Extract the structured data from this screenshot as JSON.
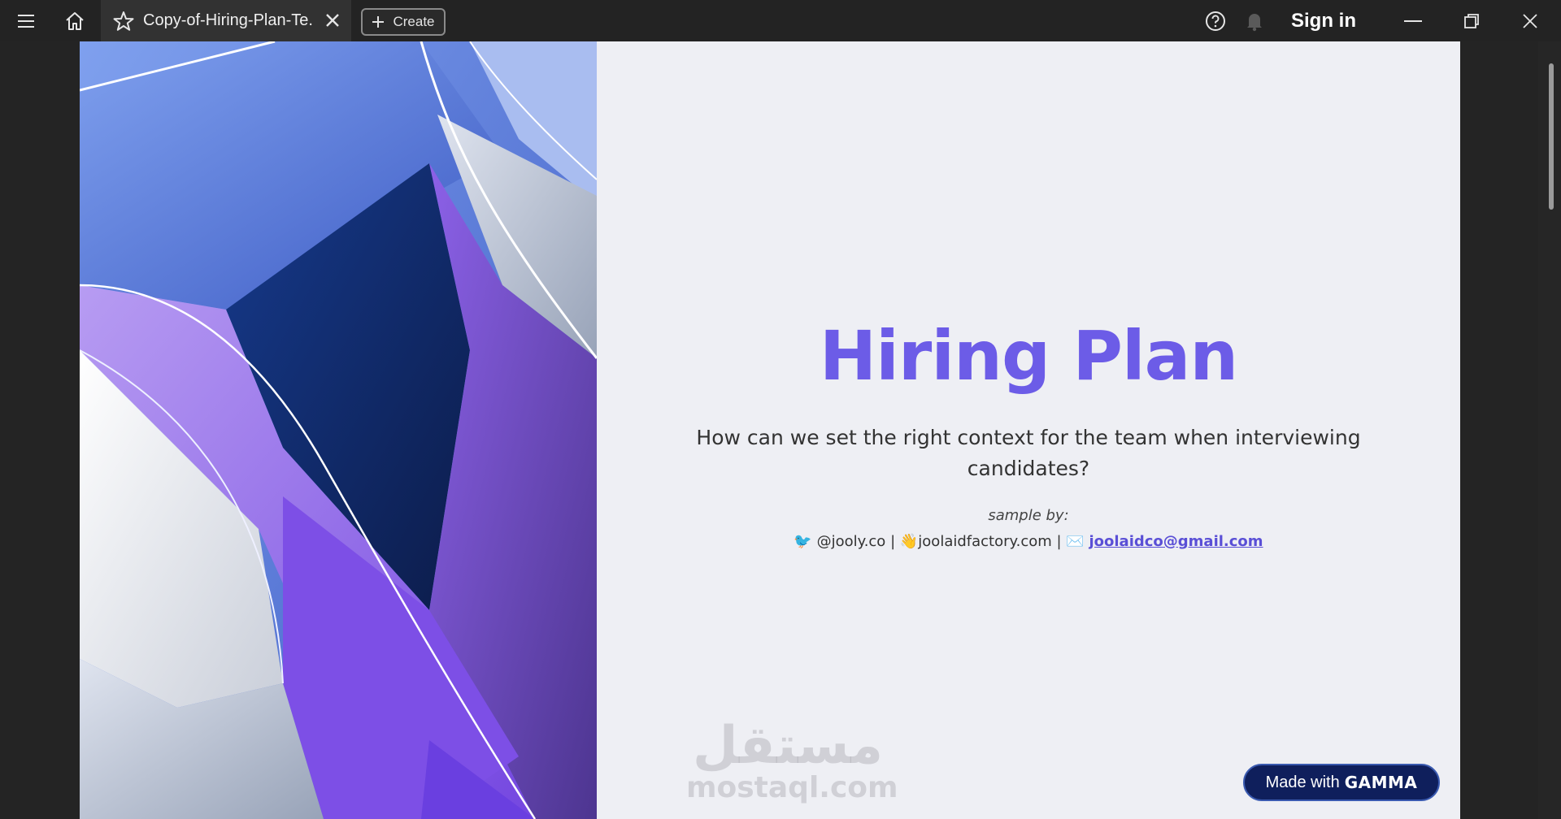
{
  "topbar": {
    "tab_title": "Copy-of-Hiring-Plan-Te...",
    "create_label": "Create",
    "signin_label": "Sign in",
    "icons": [
      "menu-icon",
      "home-icon",
      "star-icon",
      "close-icon",
      "plus-icon",
      "help-icon",
      "bell-icon",
      "minimize-icon",
      "maximize-icon",
      "close-window-icon"
    ]
  },
  "document": {
    "title": "Hiring Plan",
    "subtitle": "How can we set the right context for the team when interviewing candidates?",
    "sample_label": "sample  by:",
    "contacts": {
      "twitter_emoji": "🐦",
      "twitter": "@jooly.co",
      "separator": "|",
      "wave_emoji": "👋",
      "website": "joolaidfactory.com",
      "mail_emoji": "✉️",
      "email": "joolaidco@gmail.com"
    },
    "watermark_arabic": "مستقل",
    "watermark_latin": "mostaql.com",
    "badge": {
      "prefix": "Made with",
      "brand": "GAMMA"
    }
  },
  "colors": {
    "title": "#6c5ce7",
    "badge_bg": "#0f1f5c",
    "doc_bg": "#eeeff4",
    "chrome_bg": "#232323"
  }
}
